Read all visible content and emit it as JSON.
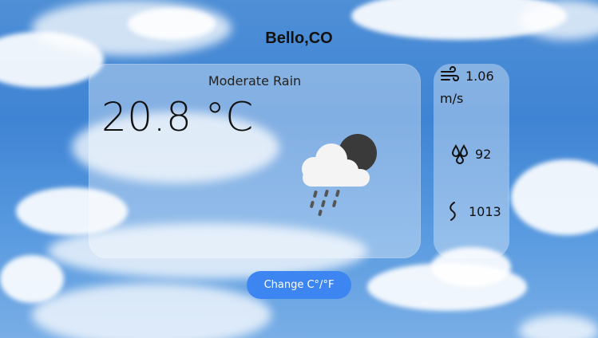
{
  "location": {
    "city": "Bello,CO"
  },
  "current": {
    "condition": "Moderate Rain",
    "temperature": "20.8 °C",
    "icon": "rain-cloud-moon-icon"
  },
  "stats": {
    "wind_value": "1.06",
    "wind_unit": "m/s",
    "humidity": "92",
    "pressure": "1013",
    "wind_icon": "wind-icon",
    "humidity_icon": "droplets-icon",
    "pressure_icon": "pressure-icon"
  },
  "controls": {
    "toggle_label": "Change C°/°F"
  },
  "colors": {
    "button": "#3d86f2",
    "card": "rgba(255,255,255,0.35)"
  }
}
